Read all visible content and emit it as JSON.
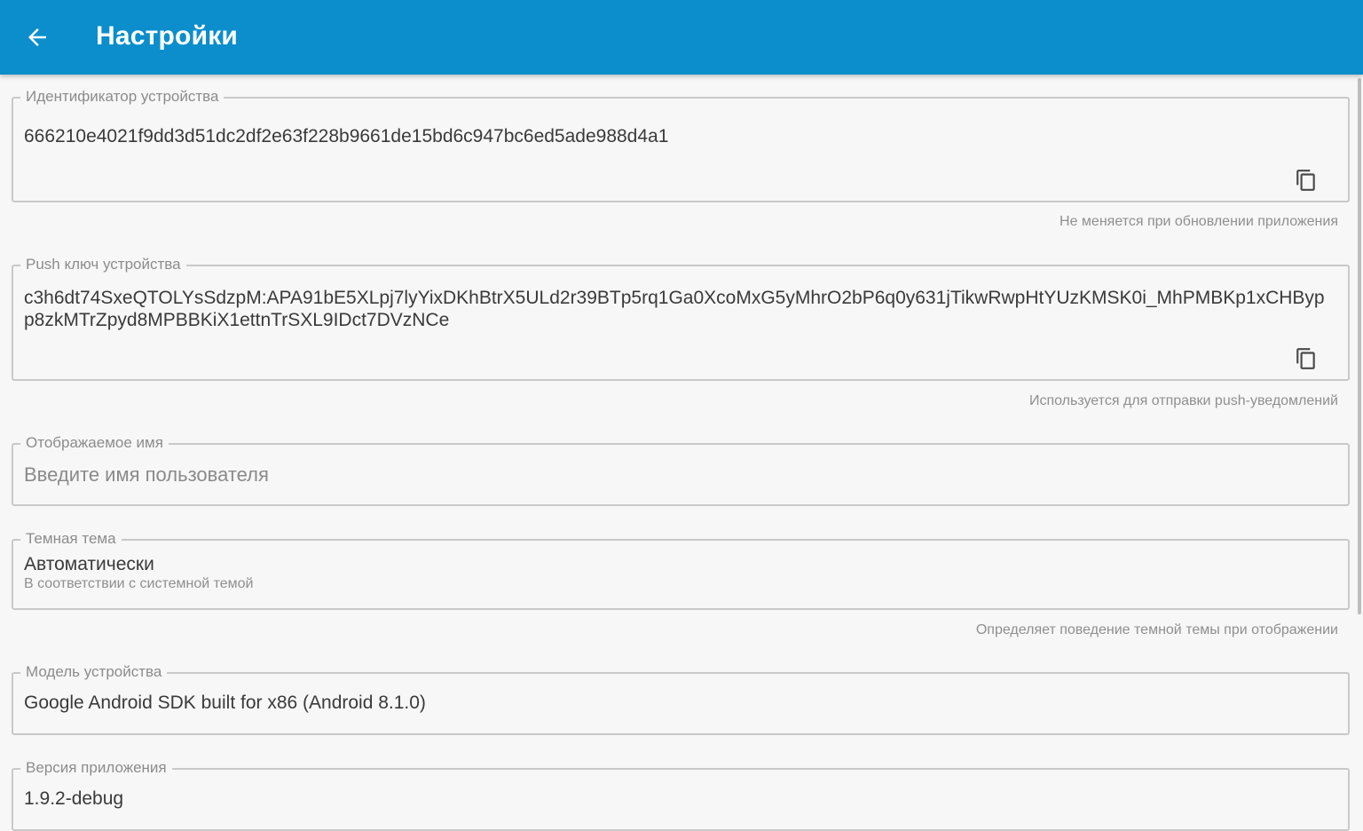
{
  "header": {
    "title": "Настройки",
    "back_icon": "arrow-back-icon",
    "background": "#0b8ecb"
  },
  "device_id": {
    "label": "Идентификатор устройства",
    "value": "666210e4021f9dd3d51dc2df2e63f228b9661de15bd6c947bc6ed5ade988d4a1",
    "helper": "Не меняется при обновлении приложения",
    "action_icon": "copy-icon"
  },
  "push_key": {
    "label": "Push ключ устройства",
    "value": "c3h6dt74SxeQTOLYsSdzpM:APA91bE5XLpj7lyYixDKhBtrX5ULd2r39BTp5rq1Ga0XcoMxG5yMhrO2bP6q0y631jTikwRwpHtYUzKMSK0i_MhPMBKp1xCHBypp8zkMTrZpyd8MPBBKiX1ettnTrSXL9IDct7DVzNCe",
    "helper": "Используется для отправки push-уведомлений",
    "action_icon": "copy-icon"
  },
  "display_name": {
    "label": "Отображаемое имя",
    "value": "",
    "placeholder": "Введите имя пользователя"
  },
  "dark_theme": {
    "label": "Темная тема",
    "value": "Автоматически",
    "sub": "В соответствии с системной темой",
    "helper": "Определяет поведение темной темы при отображении"
  },
  "device_model": {
    "label": "Модель устройства",
    "value": "Google Android SDK built for x86 (Android 8.1.0)"
  },
  "app_version": {
    "label": "Версия приложения",
    "value": "1.9.2-debug"
  }
}
